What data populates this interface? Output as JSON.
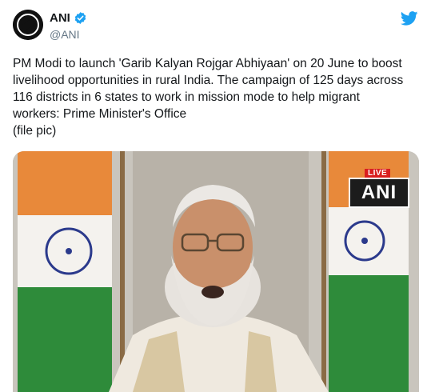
{
  "author": {
    "display_name": "ANI",
    "handle": "@ANI",
    "avatar_logo_text": "ANI",
    "verified": true
  },
  "tweet": {
    "text_lines": [
      "PM Modi to launch 'Garib Kalyan Rojgar Abhiyaan' on 20 June to boost",
      "livelihood opportunities in rural India. The campaign of 125 days across",
      "116 districts in 6 states to work in mission mode to help migrant",
      "workers: Prime Minister's Office",
      "(file pic)"
    ]
  },
  "media": {
    "live_label": "LIVE",
    "channel_logo": "ANI"
  },
  "icons": {
    "verified": "verified-badge-icon",
    "platform": "twitter-bird-icon"
  },
  "colors": {
    "text": "#14171a",
    "muted": "#657786",
    "twitter_blue": "#1da1f2",
    "live_red": "#d91e1e"
  }
}
